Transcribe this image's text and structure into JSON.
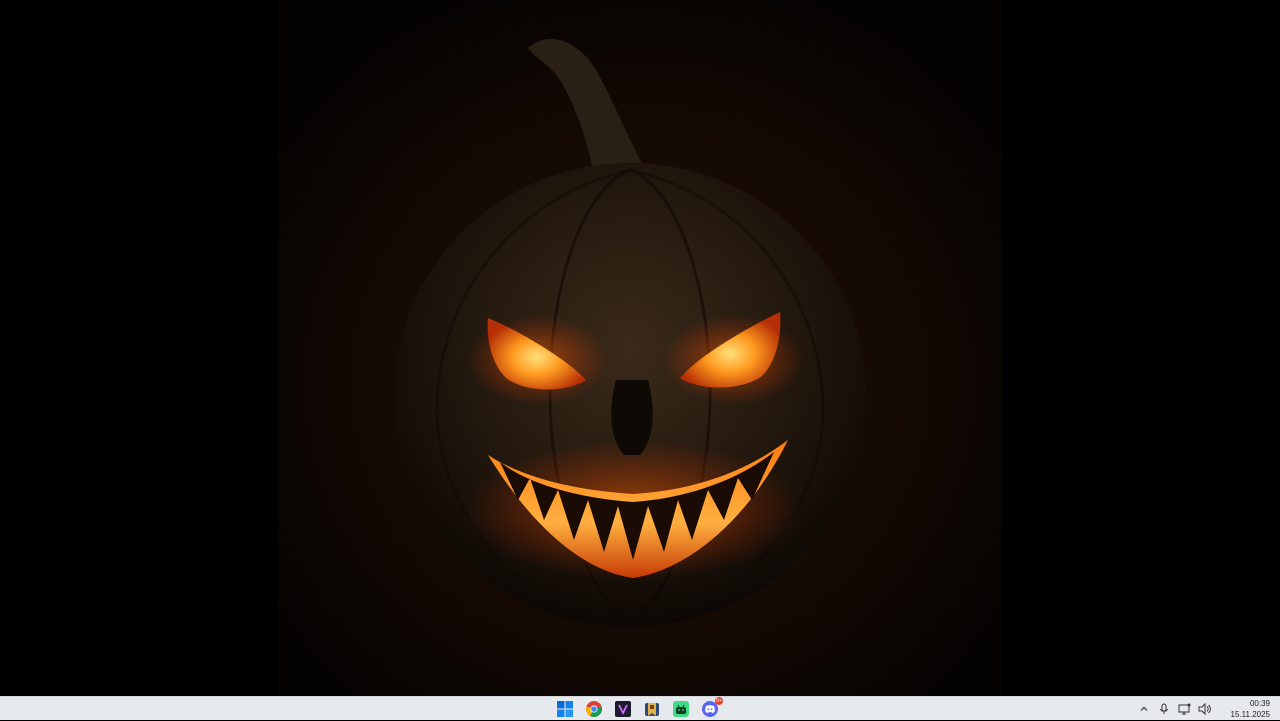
{
  "desktop": {
    "wallpaper_subject": "jack-o-lantern-wallpaper"
  },
  "taskbar": {
    "pinned": [
      {
        "id": "start",
        "icon": "windows-logo-icon"
      },
      {
        "id": "chrome",
        "icon": "chrome-icon"
      },
      {
        "id": "editor",
        "icon": "editor-app-icon"
      },
      {
        "id": "files",
        "icon": "book-app-icon"
      },
      {
        "id": "android",
        "icon": "android-app-icon"
      },
      {
        "id": "discord",
        "icon": "discord-icon",
        "badge": "9+"
      }
    ],
    "tray": {
      "icons": [
        "chevron-up-icon",
        "microphone-icon",
        "network-icon",
        "volume-icon"
      ]
    },
    "clock": {
      "time": "00:39",
      "date": "15.11.2025"
    }
  },
  "colors": {
    "taskbar_bg": "#e6e9ee",
    "glow": "#ff8a1a",
    "accent_blue": "#0a6cd4",
    "discord": "#5865f2"
  }
}
